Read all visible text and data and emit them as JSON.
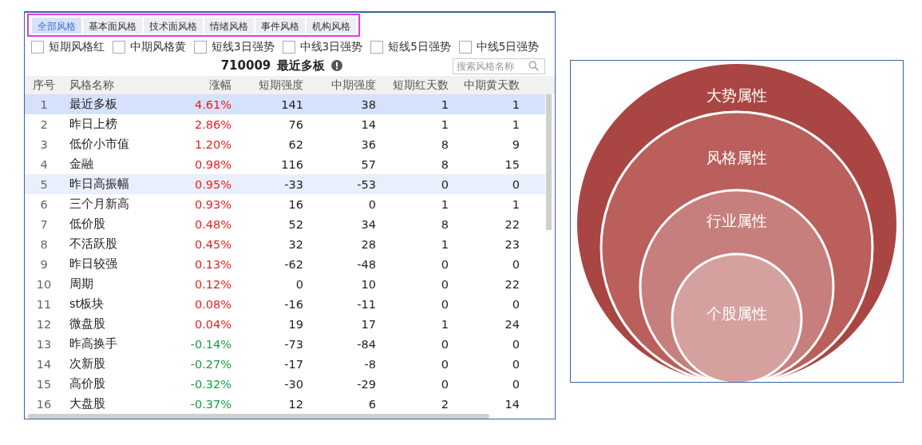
{
  "style_panel": {
    "tabs": [
      {
        "label": "全部风格",
        "selected": true
      },
      {
        "label": "基本面风格",
        "selected": false
      },
      {
        "label": "技术面风格",
        "selected": false
      },
      {
        "label": "情绪风格",
        "selected": false
      },
      {
        "label": "事件风格",
        "selected": false
      },
      {
        "label": "机构风格",
        "selected": false
      }
    ],
    "tabs_outlined": true,
    "filters": [
      {
        "label": "短期风格红",
        "checked": false
      },
      {
        "label": "中期风格黄",
        "checked": false
      },
      {
        "label": "短线3日强势",
        "checked": false
      },
      {
        "label": "中线3日强势",
        "checked": false
      },
      {
        "label": "短线5日强势",
        "checked": false
      },
      {
        "label": "中线5日强势",
        "checked": false
      }
    ],
    "title_code": "710009",
    "title_name": "最近多板",
    "search": {
      "placeholder": "搜索风格名称"
    },
    "table": {
      "columns": [
        "序号",
        "风格名称",
        "涨幅",
        "短期强度",
        "中期强度",
        "短期红天数",
        "中期黄天数"
      ],
      "rows": [
        {
          "cells": [
            "1",
            "最近多板",
            "4.61%",
            "141",
            "38",
            "1",
            "1"
          ],
          "color": "#ee1c1c",
          "selected": true,
          "hovered": false
        },
        {
          "cells": [
            "2",
            "昨日上榜",
            "2.86%",
            "76",
            "14",
            "1",
            "1"
          ],
          "color": "#ee1c1c",
          "selected": false,
          "hovered": false
        },
        {
          "cells": [
            "3",
            "低价小市值",
            "1.20%",
            "62",
            "36",
            "8",
            "9"
          ],
          "color": "#ee1c1c",
          "selected": false,
          "hovered": false
        },
        {
          "cells": [
            "4",
            "金融",
            "0.98%",
            "116",
            "57",
            "8",
            "15"
          ],
          "color": "#ee1c1c",
          "selected": false,
          "hovered": false
        },
        {
          "cells": [
            "5",
            "昨日高振幅",
            "0.95%",
            "-33",
            "-53",
            "0",
            "0"
          ],
          "color": "#ee1c1c",
          "selected": false,
          "hovered": true
        },
        {
          "cells": [
            "6",
            "三个月新高",
            "0.93%",
            "16",
            "0",
            "1",
            "1"
          ],
          "color": "#ee1c1c",
          "selected": false,
          "hovered": false
        },
        {
          "cells": [
            "7",
            "低价股",
            "0.48%",
            "52",
            "34",
            "8",
            "22"
          ],
          "color": "#ee1c1c",
          "selected": false,
          "hovered": false
        },
        {
          "cells": [
            "8",
            "不活跃股",
            "0.45%",
            "32",
            "28",
            "1",
            "23"
          ],
          "color": "#ee1c1c",
          "selected": false,
          "hovered": false
        },
        {
          "cells": [
            "9",
            "昨日较强",
            "0.13%",
            "-62",
            "-48",
            "0",
            "0"
          ],
          "color": "#ee1c1c",
          "selected": false,
          "hovered": false
        },
        {
          "cells": [
            "10",
            "周期",
            "0.12%",
            "0",
            "10",
            "0",
            "22"
          ],
          "color": "#ee1c1c",
          "selected": false,
          "hovered": false
        },
        {
          "cells": [
            "11",
            "st板块",
            "0.08%",
            "-16",
            "-11",
            "0",
            "0"
          ],
          "color": "#ee1c1c",
          "selected": false,
          "hovered": false
        },
        {
          "cells": [
            "12",
            "微盘股",
            "0.04%",
            "19",
            "17",
            "1",
            "24"
          ],
          "color": "#ee1c1c",
          "selected": false,
          "hovered": false
        },
        {
          "cells": [
            "13",
            "昨高换手",
            "-0.14%",
            "-73",
            "-84",
            "0",
            "0"
          ],
          "color": "#1a9a44",
          "selected": false,
          "hovered": false
        },
        {
          "cells": [
            "14",
            "次新股",
            "-0.27%",
            "-17",
            "-8",
            "0",
            "0"
          ],
          "color": "#1a9a44",
          "selected": false,
          "hovered": false
        },
        {
          "cells": [
            "15",
            "高价股",
            "-0.32%",
            "-30",
            "-29",
            "0",
            "0"
          ],
          "color": "#1a9a44",
          "selected": false,
          "hovered": false
        },
        {
          "cells": [
            "16",
            "大盘股",
            "-0.37%",
            "12",
            "6",
            "2",
            "14"
          ],
          "color": "#1a9a44",
          "selected": false,
          "hovered": false
        }
      ]
    }
  },
  "diagram": {
    "circles": [
      {
        "label": "大势属性",
        "color": "#a94643"
      },
      {
        "label": "风格属性",
        "color": "#ba5f5b"
      },
      {
        "label": "行业属性",
        "color": "#c67f7c"
      },
      {
        "label": "个股属性",
        "color": "#d5a19f"
      }
    ]
  }
}
